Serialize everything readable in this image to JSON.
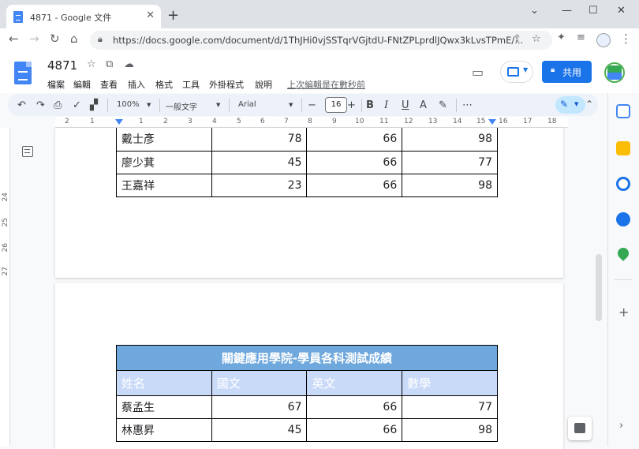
{
  "browser": {
    "tab_title": "4871 - Google 文件",
    "tab_close": "✕",
    "new_tab": "+",
    "url": "https://docs.google.com/document/d/1ThJHi0vjSSTqrVGjtdU-FNtZPLprdlJQwx3kLvsTPmE/...",
    "window_minimize": "⌄",
    "window_min2": "—",
    "window_max": "☐",
    "window_close": "✕"
  },
  "docs": {
    "title": "4871",
    "menu": [
      "檔案",
      "編輯",
      "查看",
      "插入",
      "格式",
      "工具",
      "外掛程式",
      "說明"
    ],
    "last_edit": "上次編輯是在數秒前",
    "share_label": "共用"
  },
  "toolbar": {
    "zoom": "100%",
    "style": "一般文字",
    "font": "Arial",
    "font_size": "16",
    "bold": "B",
    "italic": "I",
    "underline": "U",
    "text_color": "A",
    "more": "⋯"
  },
  "ruler": {
    "labels": [
      "2",
      "1",
      "1",
      "2",
      "3",
      "4",
      "5",
      "6",
      "7",
      "8",
      "9",
      "10",
      "11",
      "12",
      "13",
      "14",
      "15",
      "16",
      "17",
      "18"
    ],
    "vertical_labels": [
      "24",
      "25",
      "26",
      "27"
    ]
  },
  "table_top": {
    "rows": [
      [
        "戴士彥",
        "78",
        "66",
        "98"
      ],
      [
        "廖少萁",
        "45",
        "66",
        "77"
      ],
      [
        "王嘉祥",
        "23",
        "66",
        "98"
      ]
    ]
  },
  "table_main": {
    "title": "關鍵應用學院-學員各科測試成績",
    "headers": [
      "姓名",
      "國文",
      "英文",
      "數學"
    ],
    "rows": [
      [
        "蔡孟生",
        "67",
        "66",
        "77"
      ],
      [
        "林惠昇",
        "45",
        "66",
        "98"
      ]
    ]
  },
  "colors": {
    "accent": "#1a73e8",
    "table_header": "#6fa8dc",
    "table_colhead": "#c9daf8"
  }
}
